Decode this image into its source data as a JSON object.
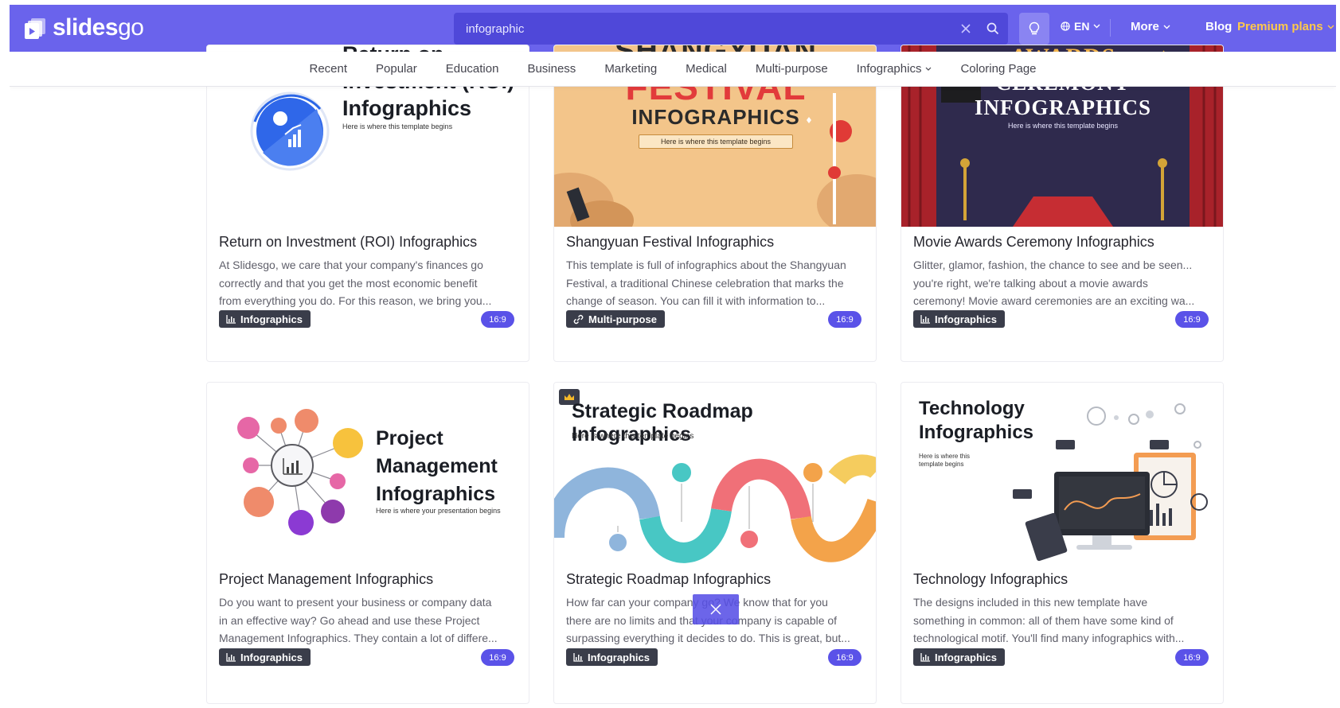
{
  "header": {
    "logo_bold": "slides",
    "logo_thin": "go",
    "search_value": "infographic",
    "lang": "EN",
    "more": "More",
    "blog": "Blog",
    "premium": "Premium plans",
    "colors": {
      "bar": "#6a63ec",
      "search": "#4f48d9",
      "premium": "#ffc94a"
    }
  },
  "categories": [
    "Recent",
    "Popular",
    "Education",
    "Business",
    "Marketing",
    "Medical",
    "Multi-purpose",
    "Infographics",
    "Coloring Page"
  ],
  "cards": [
    {
      "thumb_title": [
        "Return on",
        "Investment (ROI)",
        "Infographics"
      ],
      "thumb_sub": "Here is where this template begins",
      "title": "Return on Investment (ROI) Infographics",
      "desc": [
        "At Slidesgo, we care that your company's finances go",
        "correctly and that you get the most economic benefit",
        "from everything you do. For this reason, we bring you..."
      ],
      "tag": "Infographics",
      "tag_icon": "bar-chart-icon",
      "ratio": "16:9"
    },
    {
      "thumb_title": [
        "SHANGYUAN",
        "FESTIVAL",
        "INFOGRAPHICS"
      ],
      "thumb_sub": "Here is where this template begins",
      "title": "Shangyuan Festival Infographics",
      "desc": [
        "This template is full of infographics about the Shangyuan",
        "Festival, a traditional Chinese celebration that marks the",
        "change of season. You can fill it with information to..."
      ],
      "tag": "Multi-purpose",
      "tag_icon": "link-icon",
      "ratio": "16:9"
    },
    {
      "thumb_title": [
        "AWARDS",
        "CEREMONY",
        "INFOGRAPHICS"
      ],
      "thumb_sub": "Here is where this template begins",
      "title": "Movie Awards Ceremony Infographics",
      "desc": [
        "Glitter, glamor, fashion, the chance to see and be seen...",
        "you're right, we're talking about a movie awards",
        "ceremony! Movie award ceremonies are an exciting wa..."
      ],
      "tag": "Infographics",
      "tag_icon": "bar-chart-icon",
      "ratio": "16:9"
    },
    {
      "thumb_title": [
        "Project",
        "Management",
        "Infographics"
      ],
      "thumb_sub": "Here is where your presentation begins",
      "title": "Project Management Infographics",
      "desc": [
        "Do you want to present your business or company data",
        "in an effective way? Go ahead and use these Project",
        "Management Infographics. They contain a lot of differe..."
      ],
      "tag": "Infographics",
      "tag_icon": "bar-chart-icon",
      "ratio": "16:9"
    },
    {
      "thumb_title": [
        "Strategic Roadmap Infographics"
      ],
      "thumb_sub": "Here is where this template begins",
      "title": "Strategic Roadmap Infographics",
      "desc": [
        "How far can your company go? We know that for you",
        "there are no limits and that your company is capable of",
        "surpassing everything it decides to do. This is great, but..."
      ],
      "tag": "Infographics",
      "tag_icon": "bar-chart-icon",
      "ratio": "16:9",
      "premium_badge": "crown-icon"
    },
    {
      "thumb_title": [
        "Technology",
        "Infographics"
      ],
      "thumb_sub": "Here is where this template begins",
      "title": "Technology Infographics",
      "desc": [
        "The designs included in this new template have",
        "something in common: all of them have some kind of",
        "technological motif. You'll find many infographics with..."
      ],
      "tag": "Infographics",
      "tag_icon": "bar-chart-icon",
      "ratio": "16:9"
    }
  ]
}
